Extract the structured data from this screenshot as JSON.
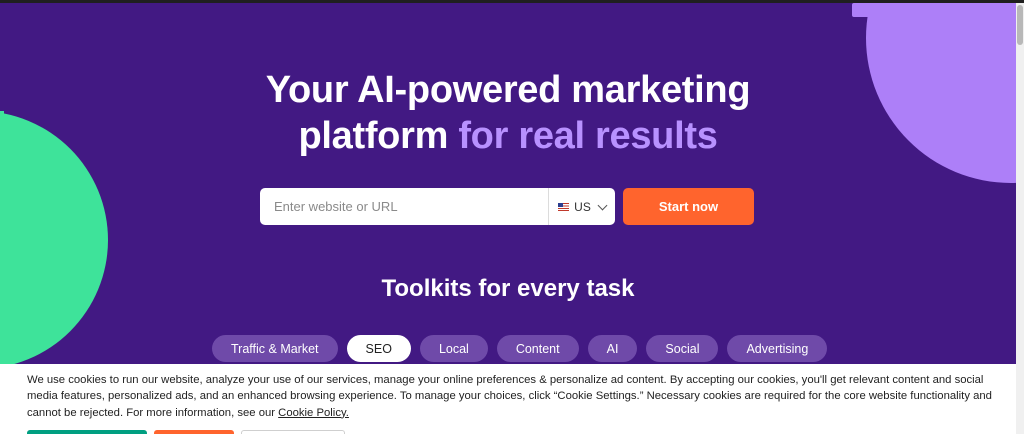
{
  "hero": {
    "headline_line1": "Your AI-powered marketing",
    "headline_line2_plain": "platform ",
    "headline_line2_accent": "for real results"
  },
  "search": {
    "placeholder": "Enter website or URL",
    "value": "",
    "country": "US",
    "country_flag_icon": "us-flag-icon"
  },
  "cta": {
    "start_label": "Start now"
  },
  "toolkits": {
    "title": "Toolkits for every task",
    "tabs": [
      {
        "label": "Traffic & Market",
        "active": false
      },
      {
        "label": "SEO",
        "active": true
      },
      {
        "label": "Local",
        "active": false
      },
      {
        "label": "Content",
        "active": false
      },
      {
        "label": "AI",
        "active": false
      },
      {
        "label": "Social",
        "active": false
      },
      {
        "label": "Advertising",
        "active": false
      }
    ]
  },
  "cookie": {
    "text": "We use cookies to run our website, analyze your use of our services, manage your online preferences & personalize ad content. By accepting our cookies, you'll get relevant content and social media features, personalized ads, and an enhanced browsing experience. To manage your choices, click “Cookie Settings.” Necessary cookies are required for the core website functionality and cannot be rejected. For more information, see our ",
    "link_label": "Cookie Policy."
  },
  "colors": {
    "background": "#421983",
    "accent_text": "#b891ff",
    "cta": "#ff642d",
    "green_shape": "#3ee39a",
    "purple_shape": "#ad7ff8",
    "accept_button": "#009f81"
  }
}
